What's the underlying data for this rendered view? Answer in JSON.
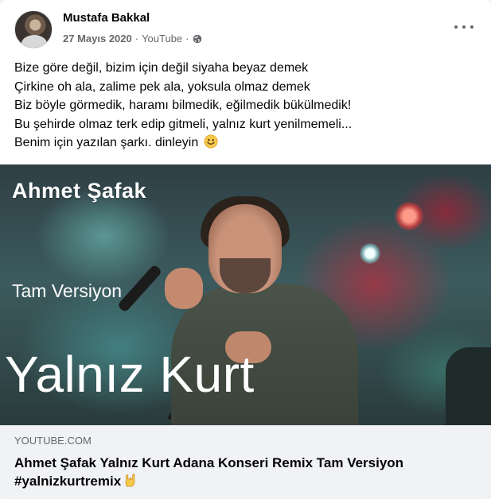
{
  "post": {
    "author": "Mustafa Bakkal",
    "date": "27 Mayıs 2020",
    "separator": "·",
    "source": "YouTube",
    "privacy_icon": "globe-icon",
    "more_icon": "more-options-icon",
    "text_lines": [
      "Bize göre değil, bizim için değil siyaha beyaz demek",
      "Çirkine oh ala, zalime pek ala, yoksula olmaz demek",
      "Biz böyle görmedik, haramı bilmedik, eğilmedik bükülmedik!",
      "Bu şehirde olmaz terk edip gitmeli, yalnız kurt yenilmemeli...",
      "Benim için yazılan şarkı. dinleyin"
    ],
    "text_emoji": "smiley-icon"
  },
  "media": {
    "artist": "Ahmet Şafak",
    "version": "Tam Versiyon",
    "song": "Yalnız Kurt"
  },
  "link_preview": {
    "domain": "YOUTUBE.COM",
    "title": "Ahmet Şafak Yalnız Kurt Adana Konseri Remix Tam Versiyon #yalnizkurtremix",
    "title_emoji": "rock-hand-icon"
  },
  "colors": {
    "text_primary": "#050505",
    "text_secondary": "#65676b",
    "preview_bg": "#f0f2f5",
    "emoji_yellow": "#f7c94b"
  }
}
